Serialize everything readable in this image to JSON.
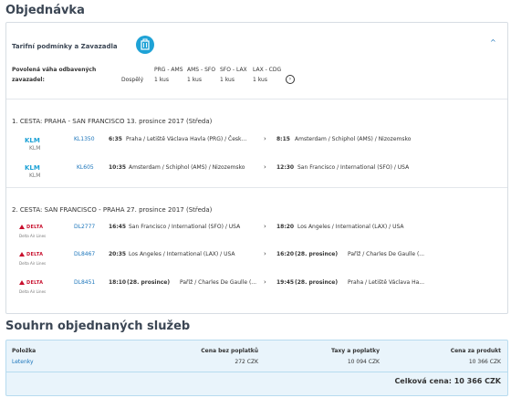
{
  "page": {
    "title": "Objednávka",
    "summary_title": "Souhrn objednaných služeb"
  },
  "tariff": {
    "title": "Tarifní podmínky a Zavazadla",
    "baggage_label_line1": "Povolená váha odbavených",
    "baggage_label_line2": "zavazadel:",
    "passenger_type": "Dospělý",
    "segments": [
      "PRG - AMS",
      "AMS - SFO",
      "SFO - LAX",
      "LAX - CDG"
    ],
    "allowances": [
      "1 kus",
      "1 kus",
      "1 kus",
      "1 kus"
    ]
  },
  "trips": [
    {
      "header": "1. CESTA: PRAHA - SAN FRANCISCO 13. prosince 2017 (Středa)",
      "flights": [
        {
          "airline": "KLM",
          "flight_no": "KL1350",
          "dep_time": "6:35",
          "dep_place": "Praha / Letiště Václava Havla (PRG) / Česk...",
          "arr_time": "8:15",
          "arr_place": "Amsterdam / Schiphol (AMS) / Nizozemsko"
        },
        {
          "airline": "KLM",
          "flight_no": "KL605",
          "dep_time": "10:35",
          "dep_place": "Amsterdam / Schiphol (AMS) / Nizozemsko",
          "arr_time": "12:30",
          "arr_place": "San Francisco / International (SFO) / USA"
        }
      ]
    },
    {
      "header": "2. CESTA: SAN FRANCISCO - PRAHA 27. prosince 2017 (Středa)",
      "flights": [
        {
          "airline": "Delta Air Lines",
          "flight_no": "DL2777",
          "dep_time": "16:45",
          "dep_place": "San Francisco / International (SFO) / USA",
          "arr_time": "18:20",
          "arr_place": "Los Angeles / International (LAX) / USA"
        },
        {
          "airline": "Delta Air Lines",
          "flight_no": "DL8467",
          "dep_time": "20:35",
          "dep_place": "Los Angeles / International (LAX) / USA",
          "arr_time": "16:20",
          "arr_date": "(28. prosince)",
          "arr_place": "Paříž / Charles De Gaulle (..."
        },
        {
          "airline": "Delta Air Lines",
          "flight_no": "DL8451",
          "dep_time": "18:10",
          "dep_date": "(28. prosince)",
          "dep_place": "Paříž / Charles De Gaulle (...",
          "arr_time": "19:45",
          "arr_date": "(28. prosince)",
          "arr_place": "Praha / Letiště Václava Ha..."
        }
      ]
    }
  ],
  "logos": {
    "klm_mark": "KLM",
    "delta_mark": "DELTA",
    "delta_sub": "Delta Air Lines"
  },
  "summary": {
    "headers": [
      "Položka",
      "Cena bez poplatků",
      "Taxy a poplatky",
      "Cena za produkt"
    ],
    "row": [
      "Letenky",
      "272 CZK",
      "10 094 CZK",
      "10 366 CZK"
    ],
    "total": "Celková cena: 10 366 CZK"
  },
  "icons": [
    "luggage-icon",
    "chevron-up-icon",
    "circle-arrow-icon",
    "chevron-right-icon",
    "klm-logo",
    "delta-logo"
  ],
  "colors": {
    "link": "#1b75bb",
    "luggage": "#1ea2d6",
    "delta": "#c8102e",
    "summary_bg": "#e9f4fb"
  }
}
